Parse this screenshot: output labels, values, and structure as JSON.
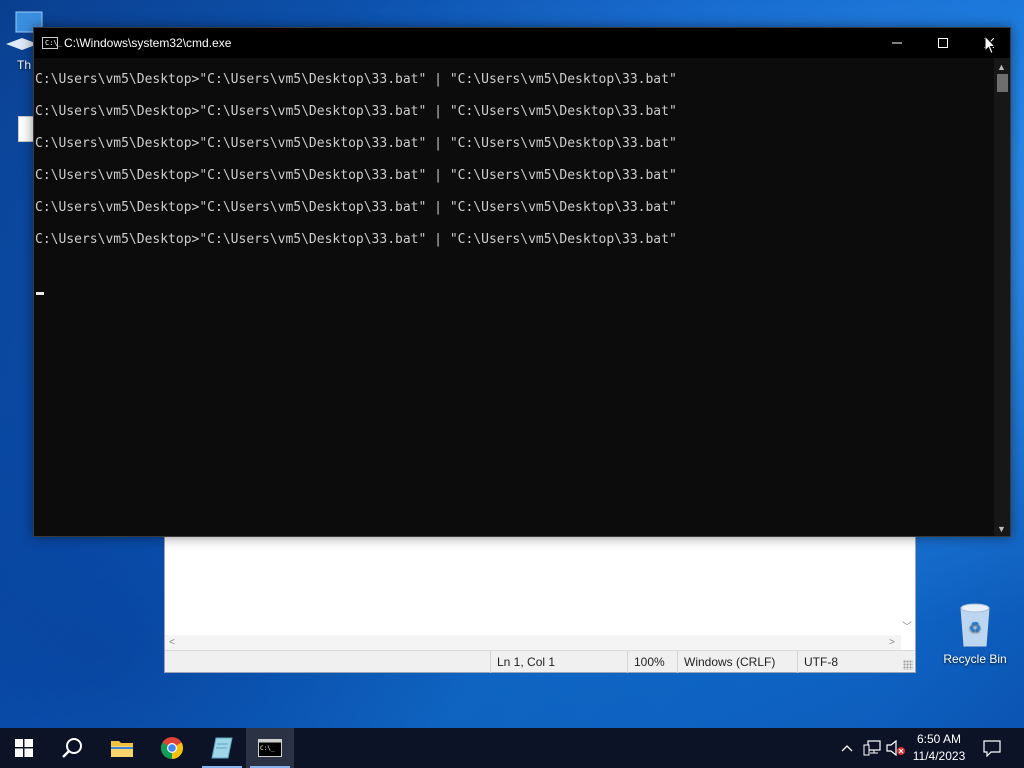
{
  "desktop": {
    "icons": [
      {
        "label": "Th"
      },
      {
        "label": "Recycle Bin"
      }
    ]
  },
  "notepad": {
    "status": {
      "position": "Ln 1, Col 1",
      "zoom": "100%",
      "line_ending": "Windows (CRLF)",
      "encoding": "UTF-8"
    }
  },
  "cmd": {
    "title": "C:\\Windows\\system32\\cmd.exe",
    "icon_text": "C:\\_",
    "lines": [
      "C:\\Users\\vm5\\Desktop>\"C:\\Users\\vm5\\Desktop\\33.bat\" | \"C:\\Users\\vm5\\Desktop\\33.bat\"",
      "C:\\Users\\vm5\\Desktop>\"C:\\Users\\vm5\\Desktop\\33.bat\" | \"C:\\Users\\vm5\\Desktop\\33.bat\"",
      "C:\\Users\\vm5\\Desktop>\"C:\\Users\\vm5\\Desktop\\33.bat\" | \"C:\\Users\\vm5\\Desktop\\33.bat\"",
      "C:\\Users\\vm5\\Desktop>\"C:\\Users\\vm5\\Desktop\\33.bat\" | \"C:\\Users\\vm5\\Desktop\\33.bat\"",
      "C:\\Users\\vm5\\Desktop>\"C:\\Users\\vm5\\Desktop\\33.bat\" | \"C:\\Users\\vm5\\Desktop\\33.bat\"",
      "C:\\Users\\vm5\\Desktop>\"C:\\Users\\vm5\\Desktop\\33.bat\" | \"C:\\Users\\vm5\\Desktop\\33.bat\""
    ]
  },
  "taskbar": {
    "apps": [
      {
        "name": "start-icon"
      },
      {
        "name": "search-icon"
      },
      {
        "name": "file-explorer-icon"
      },
      {
        "name": "chrome-icon"
      },
      {
        "name": "notepad-icon"
      },
      {
        "name": "cmd-icon",
        "active": true
      }
    ],
    "clock": {
      "time": "6:50 AM",
      "date": "11/4/2023"
    }
  },
  "colors": {
    "desktop_blue": "#0f63c9",
    "console_bg": "#0c0c0c",
    "console_text": "#cccccc",
    "taskbar": "#0c1326"
  }
}
